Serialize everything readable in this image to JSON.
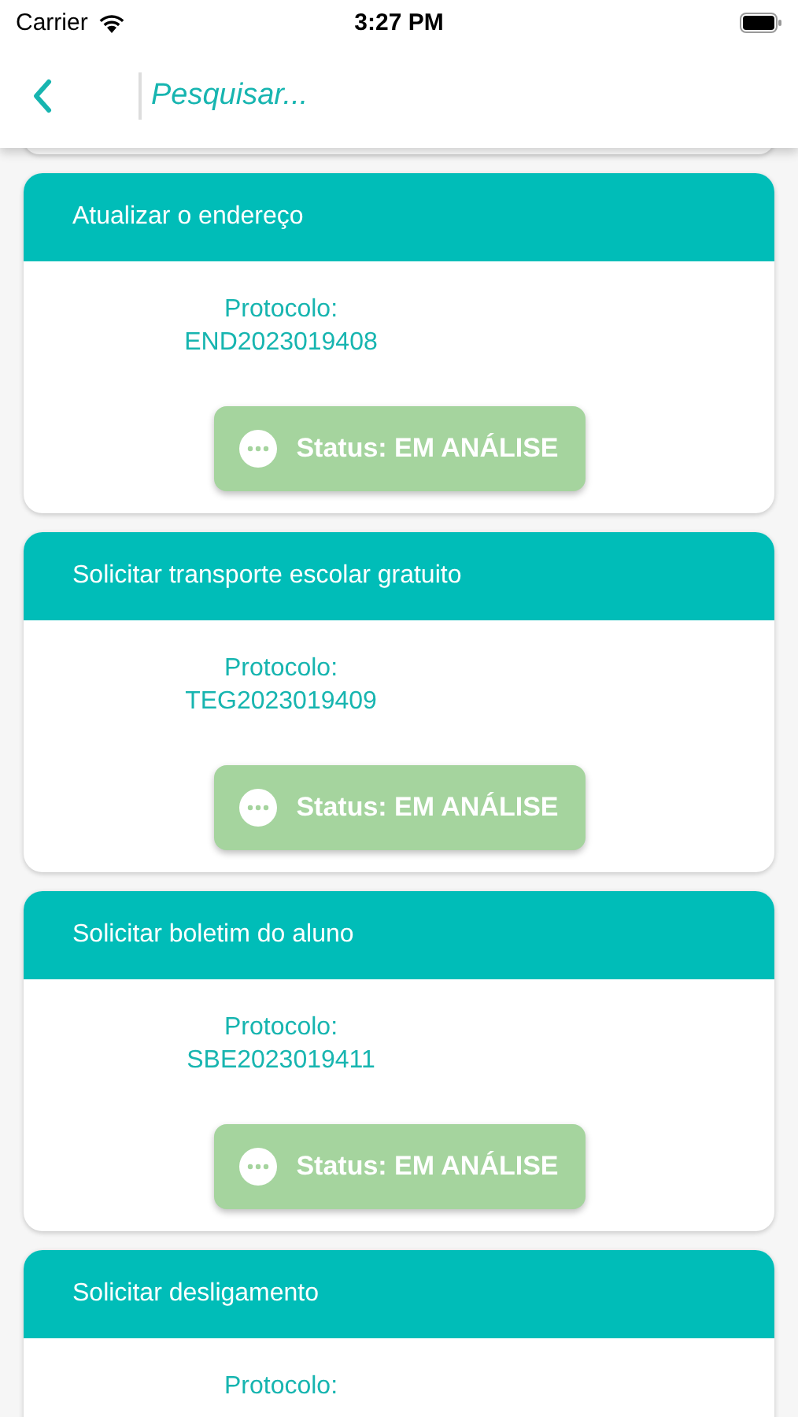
{
  "status_bar": {
    "carrier": "Carrier",
    "time": "3:27 PM"
  },
  "search": {
    "placeholder": "Pesquisar..."
  },
  "requests": [
    {
      "title": "Atualizar o endereço",
      "protocol_label": "Protocolo:",
      "protocol": "END2023019408",
      "status": "Status: EM ANÁLISE"
    },
    {
      "title": "Solicitar transporte escolar gratuito",
      "protocol_label": "Protocolo:",
      "protocol": "TEG2023019409",
      "status": "Status: EM ANÁLISE"
    },
    {
      "title": "Solicitar boletim do aluno",
      "protocol_label": "Protocolo:",
      "protocol": "SBE2023019411",
      "status": "Status: EM ANÁLISE"
    },
    {
      "title": "Solicitar desligamento",
      "protocol_label": "Protocolo:"
    }
  ]
}
